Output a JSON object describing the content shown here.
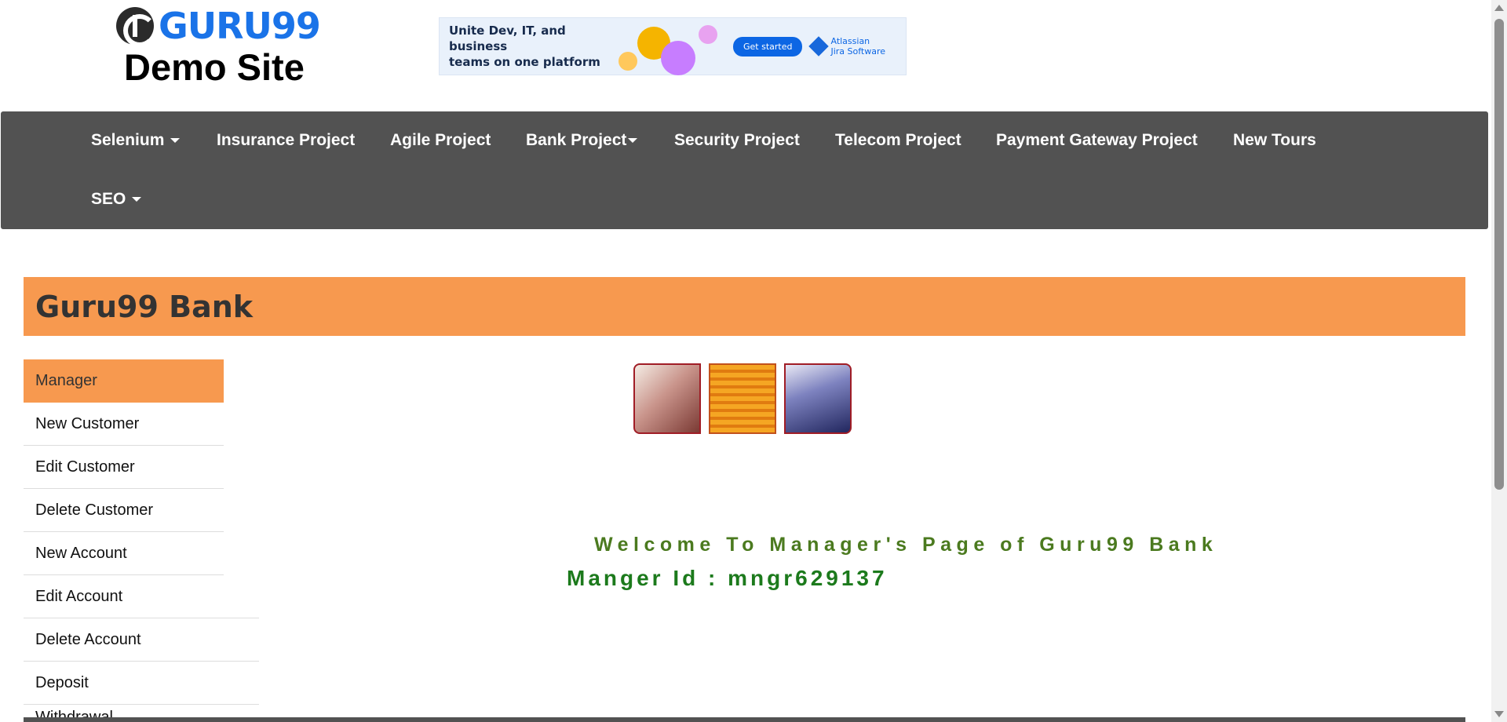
{
  "brand": {
    "logo_text": "GURU99",
    "subtitle": "Demo Site"
  },
  "ad": {
    "headline_line1": "Unite Dev, IT, and business",
    "headline_line2": "teams on one platform",
    "cta": "Get started",
    "brand_line1": "Atlassian",
    "brand_line2": "Jira Software"
  },
  "nav": {
    "items": [
      {
        "label": "Selenium",
        "dropdown": true
      },
      {
        "label": "Insurance Project",
        "dropdown": false
      },
      {
        "label": "Agile Project",
        "dropdown": false
      },
      {
        "label": "Bank Project",
        "dropdown": true
      },
      {
        "label": "Security Project",
        "dropdown": false
      },
      {
        "label": "Telecom Project",
        "dropdown": false
      },
      {
        "label": "Payment Gateway Project",
        "dropdown": false
      },
      {
        "label": "New Tours",
        "dropdown": false
      },
      {
        "label": "SEO",
        "dropdown": true
      }
    ]
  },
  "bank": {
    "title": "Guru99 Bank"
  },
  "sidebar": {
    "items": [
      {
        "label": "Manager",
        "active": true
      },
      {
        "label": "New Customer"
      },
      {
        "label": "Edit Customer"
      },
      {
        "label": "Delete Customer"
      },
      {
        "label": "New Account"
      },
      {
        "label": "Edit Account"
      },
      {
        "label": "Delete Account"
      },
      {
        "label": "Deposit"
      },
      {
        "label": "Withdrawal"
      }
    ]
  },
  "main": {
    "welcome": "Welcome To Manager's Page of Guru99 Bank",
    "manager_id": "Manger Id : mngr629137"
  },
  "colors": {
    "accent": "#f7994f",
    "nav_bg": "#525252",
    "welcome_green": "#4b7a1f"
  }
}
